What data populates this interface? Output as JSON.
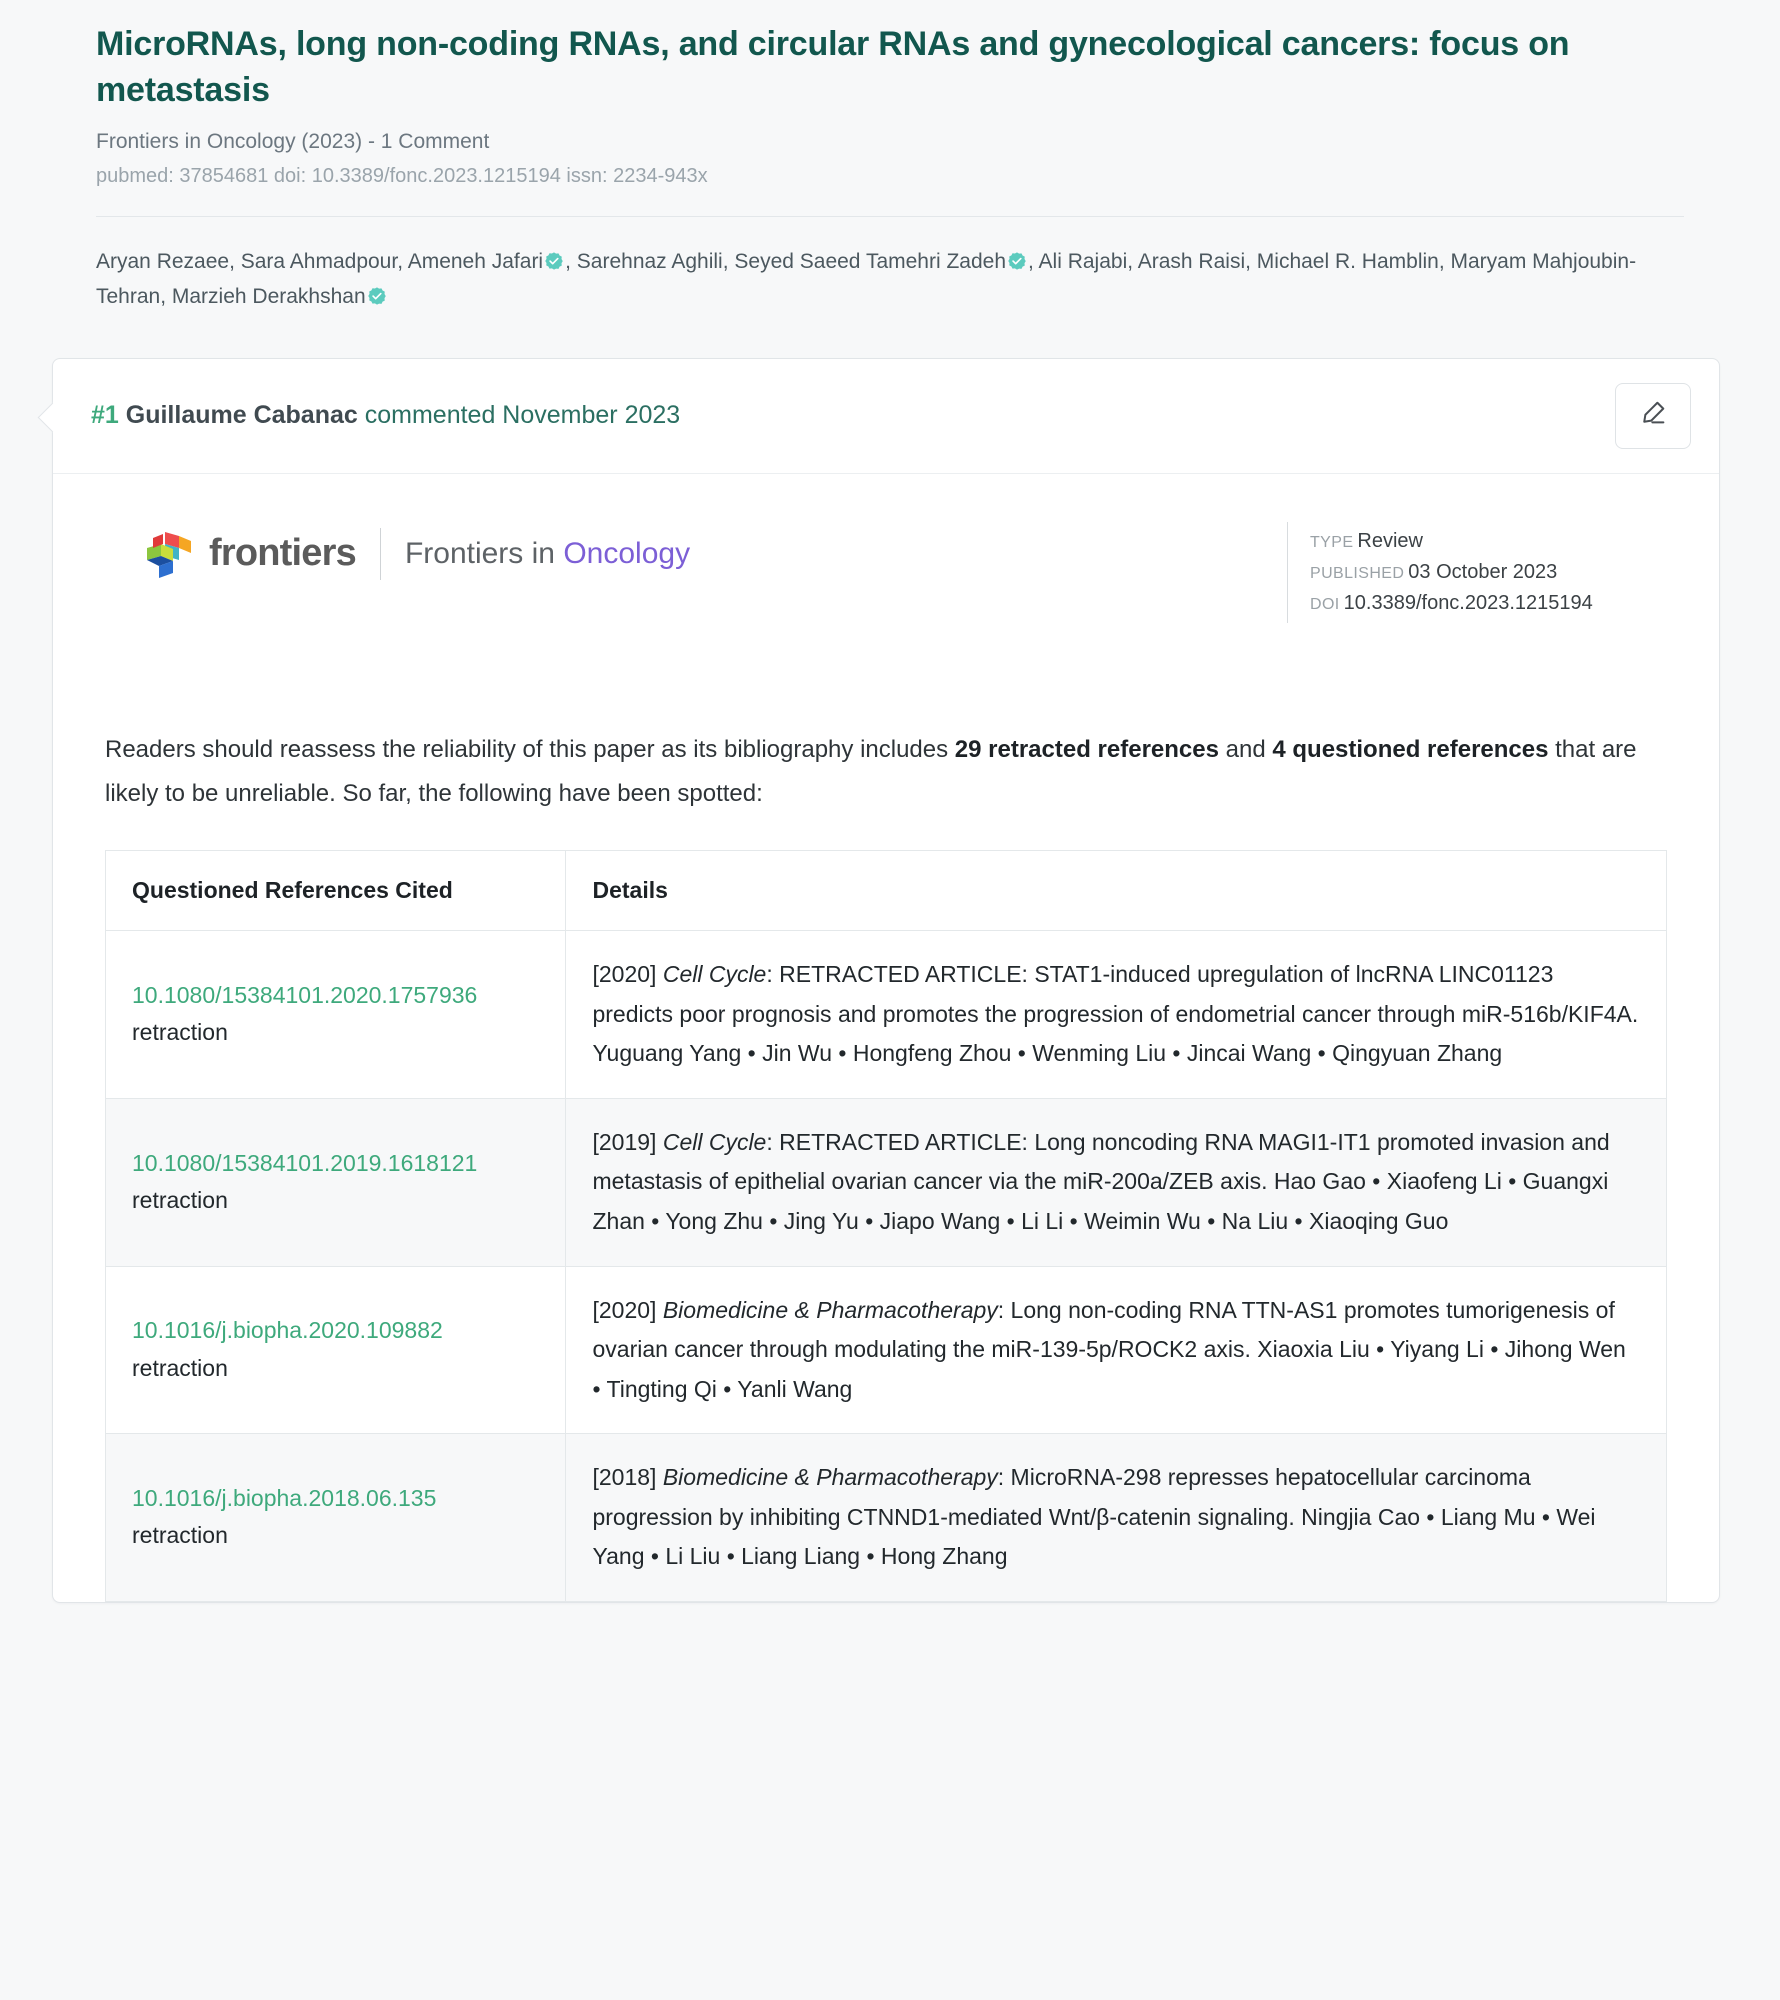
{
  "paper": {
    "title": "MicroRNAs, long non-coding RNAs, and circular RNAs and gynecological cancers: focus on metastasis",
    "venue": "Frontiers in Oncology (2023) - 1 Comment",
    "ids": "pubmed: 37854681  doi: 10.3389/fonc.2023.1215194  issn: 2234-943x",
    "authors_line_1": "Aryan Rezaee, Sara Ahmadpour, Ameneh Jafari",
    "authors_line_2": ", Sarehnaz Aghili, Seyed Saeed Tamehri Zadeh",
    "authors_line_3": ", Ali Rajabi, Arash Raisi, Michael R. Hamblin, Maryam Mahjoubin-Tehran, Marzieh Derakhshan",
    "verified_icon": "verified-badge-icon"
  },
  "comment": {
    "number": "#1",
    "author": "Guillaume Cabanac",
    "action": "commented November 2023",
    "edit_icon": "pencil-edit-icon"
  },
  "frontiers": {
    "logo_icon": "frontiers-cubes-logo",
    "wordmark": "frontiers",
    "journal_prefix": "Frontiers in ",
    "journal_name": "Oncology",
    "type_label": "TYPE",
    "type_value": "Review",
    "published_label": "PUBLISHED",
    "published_value": "03 October 2023",
    "doi_label": "DOI",
    "doi_value": "10.3389/fonc.2023.1215194",
    "journal_color": "#7c5fd6"
  },
  "body": {
    "lede_part_1": "Readers should reassess the reliability of this paper as its bibliography includes ",
    "lede_bold_1": "29 retracted references",
    "lede_part_2": " and ",
    "lede_bold_2": "4 questioned references",
    "lede_part_3": " that are likely to be unreliable. So far, the following have been spotted:"
  },
  "table": {
    "headers": [
      "Questioned References Cited",
      "Details"
    ],
    "rows": [
      {
        "doi": "10.1080/15384101.2020.1757936",
        "kind": "retraction",
        "year": "[2020] ",
        "journal": "Cell Cycle",
        "detail": ": RETRACTED ARTICLE: STAT1-induced upregulation of lncRNA LINC01123 predicts poor prognosis and promotes the progression of endometrial cancer through miR-516b/KIF4A. Yuguang Yang • Jin Wu • Hongfeng Zhou • Wenming Liu • Jincai Wang • Qingyuan Zhang"
      },
      {
        "doi": "10.1080/15384101.2019.1618121",
        "kind": "retraction",
        "year": "[2019] ",
        "journal": "Cell Cycle",
        "detail": ": RETRACTED ARTICLE: Long noncoding RNA MAGI1-IT1 promoted invasion and metastasis of epithelial ovarian cancer via the miR-200a/ZEB axis. Hao Gao • Xiaofeng Li • Guangxi Zhan • Yong Zhu • Jing Yu • Jiapo Wang • Li Li • Weimin Wu • Na Liu • Xiaoqing Guo"
      },
      {
        "doi": "10.1016/j.biopha.2020.109882",
        "kind": "retraction",
        "year": "[2020] ",
        "journal": "Biomedicine & Pharmacotherapy",
        "detail": ": Long non-coding RNA TTN-AS1 promotes tumorigenesis of ovarian cancer through modulating the miR-139-5p/ROCK2 axis. Xiaoxia Liu • Yiyang Li • Jihong Wen • Tingting Qi • Yanli Wang"
      },
      {
        "doi": "10.1016/j.biopha.2018.06.135",
        "kind": "retraction",
        "year": "[2018] ",
        "journal": "Biomedicine & Pharmacotherapy",
        "detail": ": MicroRNA-298 represses hepatocellular carcinoma progression by inhibiting CTNND1-mediated Wnt/β-catenin signaling. Ningjia Cao • Liang Mu • Wei Yang • Li Liu • Liang Liang • Hong Zhang"
      }
    ]
  },
  "colors": {
    "title": "#12574e",
    "accent_green": "#3ea97c",
    "page_bg": "#f7f8f9"
  }
}
